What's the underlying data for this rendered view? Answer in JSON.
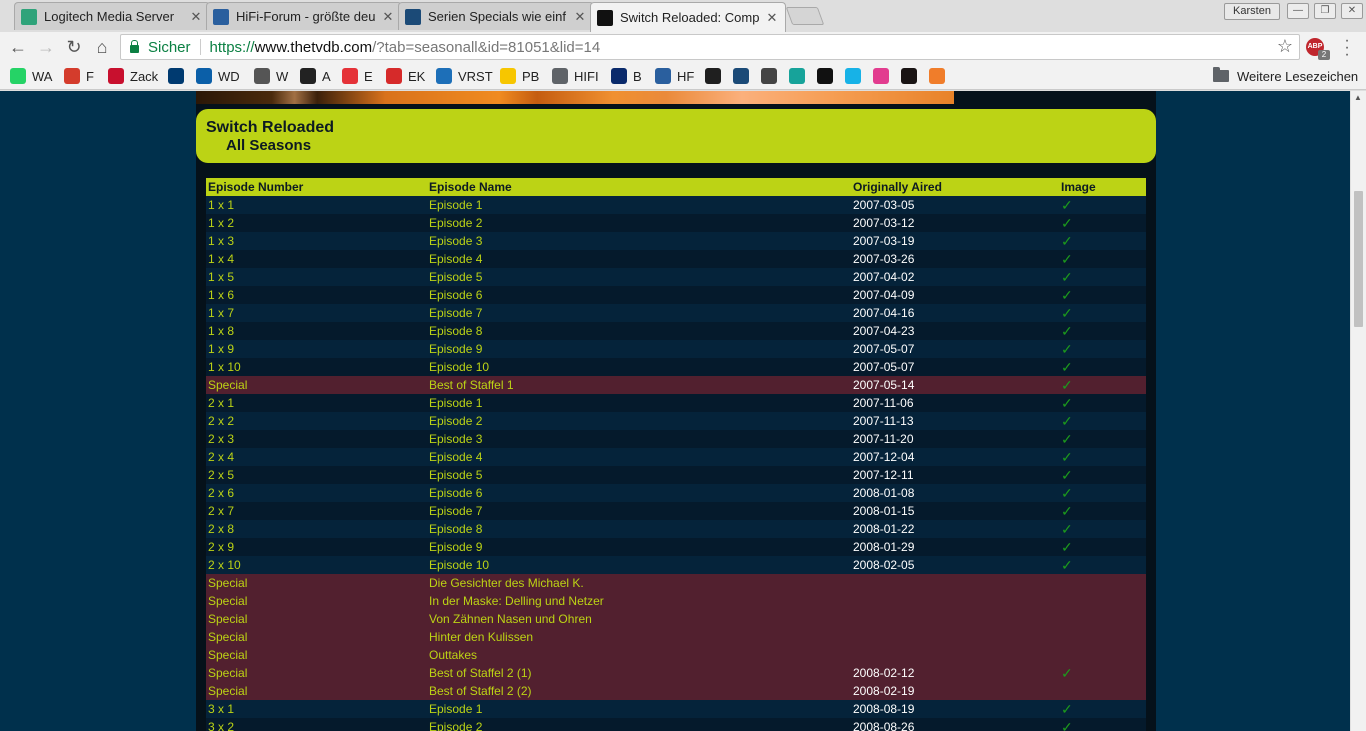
{
  "browser": {
    "tabs": [
      {
        "title": "Logitech Media Server",
        "icon": "logitech-icon",
        "color": "#2fa37a",
        "active": false
      },
      {
        "title": "HiFi-Forum - größte deu",
        "icon": "hifi-forum-icon",
        "color": "#2a5f9e",
        "active": false
      },
      {
        "title": "Serien Specials wie einf",
        "icon": "kodi-icon",
        "color": "#1b4a77",
        "active": false
      },
      {
        "title": "Switch Reloaded: Comp",
        "icon": "thetvdb-icon",
        "color": "#111111",
        "active": true
      }
    ],
    "user": "Karsten",
    "secure_label": "Sicher",
    "url_scheme": "https://",
    "url_host": "www.thetvdb.com",
    "url_rest": "/?tab=seasonall&id=81051&lid=14",
    "abp_count": "2",
    "bookmarks": [
      {
        "label": "WA",
        "icon": "whatsapp-icon",
        "color": "#25d366"
      },
      {
        "label": "F",
        "icon": "fbox-icon",
        "color": "#d43c2c"
      },
      {
        "label": "Zack",
        "icon": "avm-icon",
        "color": "#c8102e"
      },
      {
        "label": "",
        "icon": "ard-icon",
        "color": "#003a70"
      },
      {
        "label": "WD",
        "icon": "wd-icon",
        "color": "#0b5fa8"
      },
      {
        "label": "W",
        "icon": "wikipedia-icon",
        "color": "#555555"
      },
      {
        "label": "A",
        "icon": "amazon-icon",
        "color": "#222222"
      },
      {
        "label": "E",
        "icon": "ebay-icon",
        "color": "#e53238"
      },
      {
        "label": "EK",
        "icon": "ek-icon",
        "color": "#d62a2a"
      },
      {
        "label": "VRST",
        "icon": "vrst-icon",
        "color": "#1d6fb8"
      },
      {
        "label": "PB",
        "icon": "postbank-icon",
        "color": "#f7c600"
      },
      {
        "label": "HIFI",
        "icon": "folder-icon",
        "color": "#5f6368"
      },
      {
        "label": "B",
        "icon": "b-icon",
        "color": "#0a2a6b"
      },
      {
        "label": "HF",
        "icon": "hifi-forum-icon",
        "color": "#2a5f9e"
      },
      {
        "label": "",
        "icon": "plex-icon",
        "color": "#1f1f1f"
      },
      {
        "label": "",
        "icon": "kodi-icon",
        "color": "#1b4a77"
      },
      {
        "label": "",
        "icon": "clock-icon",
        "color": "#444444"
      },
      {
        "label": "",
        "icon": "music-icon",
        "color": "#17a39a"
      },
      {
        "label": "",
        "icon": "pcp-icon",
        "color": "#111111"
      },
      {
        "label": "",
        "icon": "kodi-blue-icon",
        "color": "#17b2e7"
      },
      {
        "label": "",
        "icon": "candy-icon",
        "color": "#e23c8f"
      },
      {
        "label": "",
        "icon": "spotify-icon",
        "color": "#191414"
      },
      {
        "label": "",
        "icon": "orange-gear-icon",
        "color": "#f07d2a"
      }
    ],
    "other_bookmarks": "Weitere Lesezeichen"
  },
  "page": {
    "series_title": "Switch Reloaded",
    "season_title": "All Seasons",
    "columns": [
      "Episode Number",
      "Episode Name",
      "Originally Aired",
      "Image"
    ],
    "check_mark": "✓",
    "episodes": [
      {
        "num": "1 x 1",
        "name": "Episode 1",
        "aired": "2007-03-05",
        "image": true,
        "special": false
      },
      {
        "num": "1 x 2",
        "name": "Episode 2",
        "aired": "2007-03-12",
        "image": true,
        "special": false
      },
      {
        "num": "1 x 3",
        "name": "Episode 3",
        "aired": "2007-03-19",
        "image": true,
        "special": false
      },
      {
        "num": "1 x 4",
        "name": "Episode 4",
        "aired": "2007-03-26",
        "image": true,
        "special": false
      },
      {
        "num": "1 x 5",
        "name": "Episode 5",
        "aired": "2007-04-02",
        "image": true,
        "special": false
      },
      {
        "num": "1 x 6",
        "name": "Episode 6",
        "aired": "2007-04-09",
        "image": true,
        "special": false
      },
      {
        "num": "1 x 7",
        "name": "Episode 7",
        "aired": "2007-04-16",
        "image": true,
        "special": false
      },
      {
        "num": "1 x 8",
        "name": "Episode 8",
        "aired": "2007-04-23",
        "image": true,
        "special": false
      },
      {
        "num": "1 x 9",
        "name": "Episode 9",
        "aired": "2007-05-07",
        "image": true,
        "special": false
      },
      {
        "num": "1 x 10",
        "name": "Episode 10",
        "aired": "2007-05-07",
        "image": true,
        "special": false
      },
      {
        "num": "Special",
        "name": "Best of Staffel 1",
        "aired": "2007-05-14",
        "image": true,
        "special": true
      },
      {
        "num": "2 x 1",
        "name": "Episode 1",
        "aired": "2007-11-06",
        "image": true,
        "special": false
      },
      {
        "num": "2 x 2",
        "name": "Episode 2",
        "aired": "2007-11-13",
        "image": true,
        "special": false
      },
      {
        "num": "2 x 3",
        "name": "Episode 3",
        "aired": "2007-11-20",
        "image": true,
        "special": false
      },
      {
        "num": "2 x 4",
        "name": "Episode 4",
        "aired": "2007-12-04",
        "image": true,
        "special": false
      },
      {
        "num": "2 x 5",
        "name": "Episode 5",
        "aired": "2007-12-11",
        "image": true,
        "special": false
      },
      {
        "num": "2 x 6",
        "name": "Episode 6",
        "aired": "2008-01-08",
        "image": true,
        "special": false
      },
      {
        "num": "2 x 7",
        "name": "Episode 7",
        "aired": "2008-01-15",
        "image": true,
        "special": false
      },
      {
        "num": "2 x 8",
        "name": "Episode 8",
        "aired": "2008-01-22",
        "image": true,
        "special": false
      },
      {
        "num": "2 x 9",
        "name": "Episode 9",
        "aired": "2008-01-29",
        "image": true,
        "special": false
      },
      {
        "num": "2 x 10",
        "name": "Episode 10",
        "aired": "2008-02-05",
        "image": true,
        "special": false
      },
      {
        "num": "Special",
        "name": "Die Gesichter des Michael K.",
        "aired": "",
        "image": false,
        "special": true
      },
      {
        "num": "Special",
        "name": "In der Maske: Delling und Netzer",
        "aired": "",
        "image": false,
        "special": true
      },
      {
        "num": "Special",
        "name": "Von Zähnen Nasen und Ohren",
        "aired": "",
        "image": false,
        "special": true
      },
      {
        "num": "Special",
        "name": "Hinter den Kulissen",
        "aired": "",
        "image": false,
        "special": true
      },
      {
        "num": "Special",
        "name": "Outtakes",
        "aired": "",
        "image": false,
        "special": true
      },
      {
        "num": "Special",
        "name": "Best of Staffel 2 (1)",
        "aired": "2008-02-12",
        "image": true,
        "special": true
      },
      {
        "num": "Special",
        "name": "Best of Staffel 2 (2)",
        "aired": "2008-02-19",
        "image": false,
        "special": true
      },
      {
        "num": "3 x 1",
        "name": "Episode 1",
        "aired": "2008-08-19",
        "image": true,
        "special": false
      },
      {
        "num": "3 x 2",
        "name": "Episode 2",
        "aired": "2008-08-26",
        "image": true,
        "special": false
      }
    ]
  }
}
